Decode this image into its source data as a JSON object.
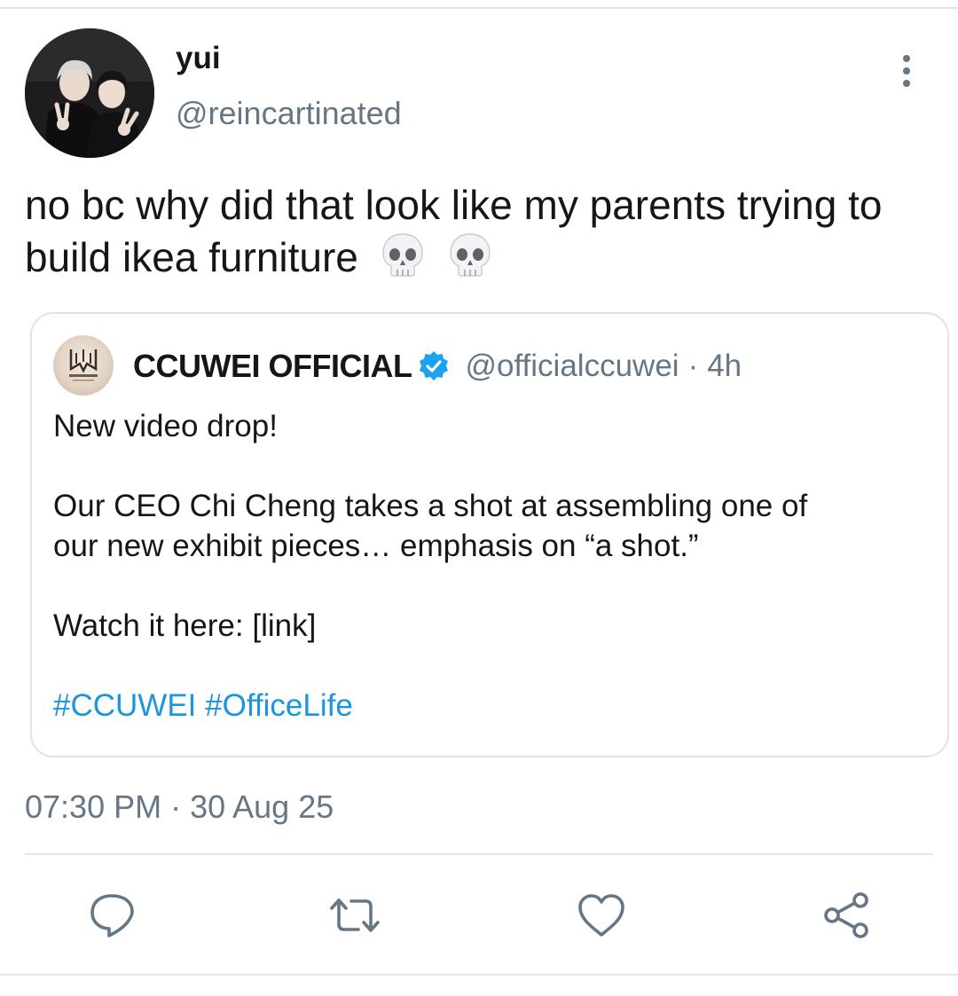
{
  "author": {
    "display_name": "yui",
    "handle": "@reincartinated"
  },
  "tweet": {
    "text": "no bc why did that look like my parents trying to build ikea furniture",
    "emoji": [
      "skull",
      "skull"
    ],
    "timestamp": "07:30 PM · 30 Aug 25"
  },
  "quoted_tweet": {
    "name": "CCUWEI OFFICIAL",
    "handle": "@officialccuwei",
    "separator": "·",
    "time": "4h",
    "verified": true,
    "lines": {
      "l1": "New video drop!",
      "l2a": "Our CEO Chi Cheng takes a shot at assembling one of",
      "l2b": "our new exhibit pieces… emphasis on “a shot.”",
      "l3": "Watch it here: [link]"
    },
    "hashtags": [
      "#CCUWEI",
      "#OfficeLife"
    ]
  },
  "actions": [
    "reply-icon",
    "retweet-icon",
    "like-icon",
    "share-icon"
  ],
  "colors": {
    "text": "#14171a",
    "secondary": "#657786",
    "link": "#1b95e0",
    "border": "#dfe3e6",
    "verified": "#1da1f2"
  }
}
